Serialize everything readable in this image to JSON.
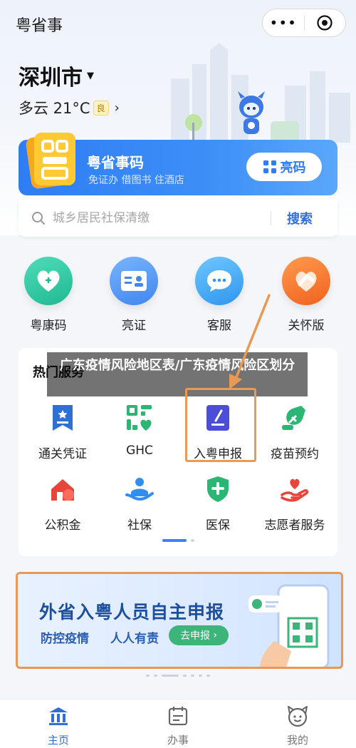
{
  "header": {
    "title": "粤省事"
  },
  "location": {
    "city": "深圳市",
    "weather": "多云 21°C",
    "aqi": "良"
  },
  "code_card": {
    "title": "粤省事码",
    "subtitle": "免证办 借图书 住酒店",
    "button": "亮码"
  },
  "search": {
    "placeholder": "城乡居民社保清缴",
    "button": "搜索"
  },
  "quick_actions": [
    {
      "label": "粤康码",
      "icon": "heart-shield-icon",
      "color": "#2fc7a3"
    },
    {
      "label": "亮证",
      "icon": "id-card-icon",
      "color": "#4a90f0"
    },
    {
      "label": "客服",
      "icon": "chat-bubble-icon",
      "color": "#3a9cf0"
    },
    {
      "label": "关怀版",
      "icon": "care-heart-icon",
      "color": "#f2762e"
    }
  ],
  "hot": {
    "title": "热门服务",
    "services": [
      {
        "label": "通关凭证",
        "icon": "pass-bookmark-icon"
      },
      {
        "label": "GHC",
        "icon": "ghc-icon"
      },
      {
        "label": "入粤申报",
        "icon": "declaration-icon"
      },
      {
        "label": "疫苗预约",
        "icon": "vaccine-icon"
      },
      {
        "label": "公积金",
        "icon": "housing-fund-icon"
      },
      {
        "label": "社保",
        "icon": "social-security-icon"
      },
      {
        "label": "医保",
        "icon": "medical-insurance-icon"
      },
      {
        "label": "志愿者服务",
        "icon": "volunteer-icon"
      }
    ]
  },
  "overlay": {
    "caption": "广东疫情风险地区表/广东疫情风险区划分"
  },
  "banner": {
    "headline": "外省入粤人员自主申报",
    "slogan_1": "防控疫情",
    "slogan_2": "人人有责",
    "button": "去申报"
  },
  "tabs": [
    {
      "label": "主页",
      "active": true
    },
    {
      "label": "办事",
      "active": false
    },
    {
      "label": "我的",
      "active": false
    }
  ]
}
